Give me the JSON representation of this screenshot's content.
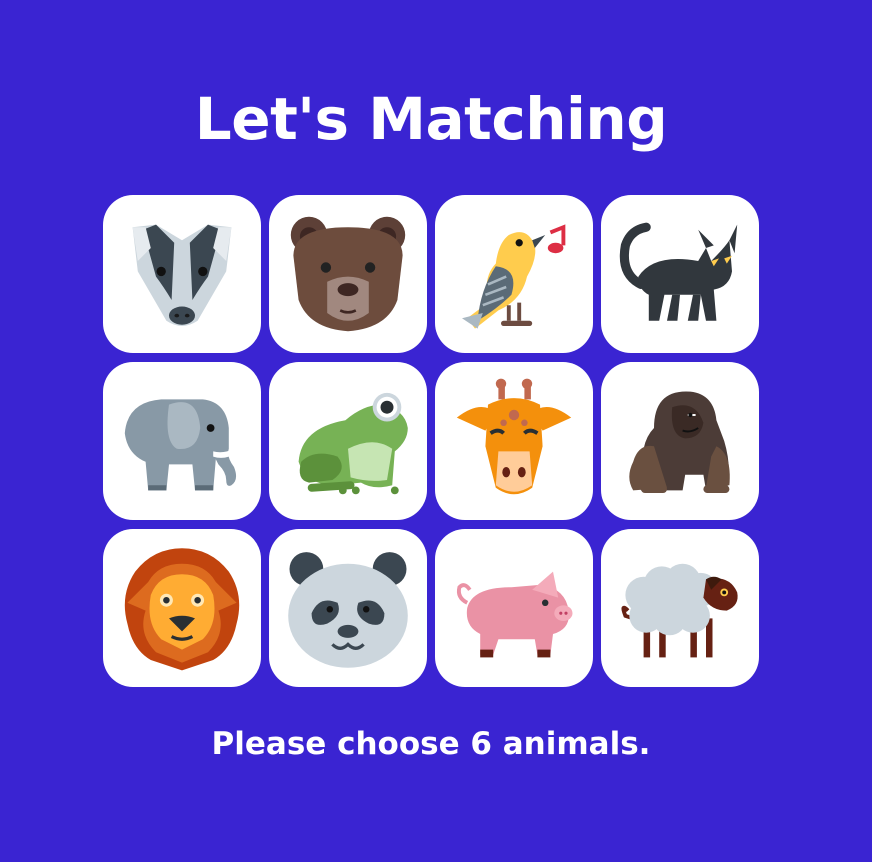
{
  "title": "Let's Matching",
  "instruction": "Please choose 6 animals.",
  "colors": {
    "background": "#3a24d2",
    "card": "#ffffff",
    "text": "#ffffff"
  },
  "animals": [
    {
      "name": "badger",
      "icon": "badger-icon"
    },
    {
      "name": "bear",
      "icon": "bear-icon"
    },
    {
      "name": "bird",
      "icon": "singing-bird-icon"
    },
    {
      "name": "black cat",
      "icon": "black-cat-icon"
    },
    {
      "name": "elephant",
      "icon": "elephant-icon"
    },
    {
      "name": "frog",
      "icon": "frog-icon"
    },
    {
      "name": "giraffe",
      "icon": "giraffe-icon"
    },
    {
      "name": "gorilla",
      "icon": "gorilla-icon"
    },
    {
      "name": "lion",
      "icon": "lion-icon"
    },
    {
      "name": "panda",
      "icon": "panda-icon"
    },
    {
      "name": "pig",
      "icon": "pig-icon"
    },
    {
      "name": "sheep",
      "icon": "sheep-icon"
    }
  ]
}
